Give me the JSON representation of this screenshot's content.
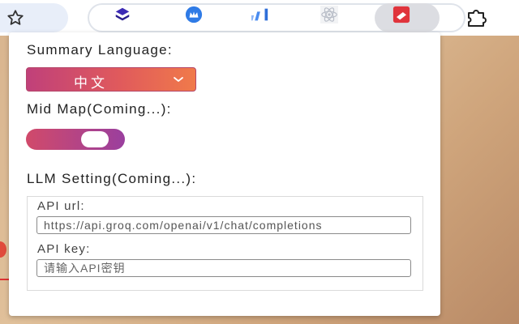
{
  "toolbar": {
    "bookmark_icon": "star-outline-icon",
    "extensions": [
      {
        "name": "layers-extension-icon",
        "color": "#3c2ab5"
      },
      {
        "name": "crown-extension-icon",
        "color": "#2f7be6"
      },
      {
        "name": "bar-chart-extension-icon",
        "color": "#4a8cf0"
      },
      {
        "name": "react-atom-extension-icon",
        "color": "#b9bec8"
      },
      {
        "name": "mail-summary-extension-icon",
        "color": "#e0343c"
      }
    ],
    "extensions_menu_icon": "puzzle-icon"
  },
  "popup": {
    "summary_language_label": "Summary Language:",
    "summary_language_value": "中文",
    "mid_map_label": "Mid Map(Coming...):",
    "mid_map_enabled": true,
    "llm_setting_label": "LLM Setting(Coming...):",
    "api_url_label": "API url:",
    "api_url_value": "https://api.groq.com/openai/v1/chat/completions",
    "api_key_label": "API key:",
    "api_key_placeholder": "请输入API密钥",
    "accent_start": "#c0407a",
    "accent_end": "#f07a4a"
  }
}
